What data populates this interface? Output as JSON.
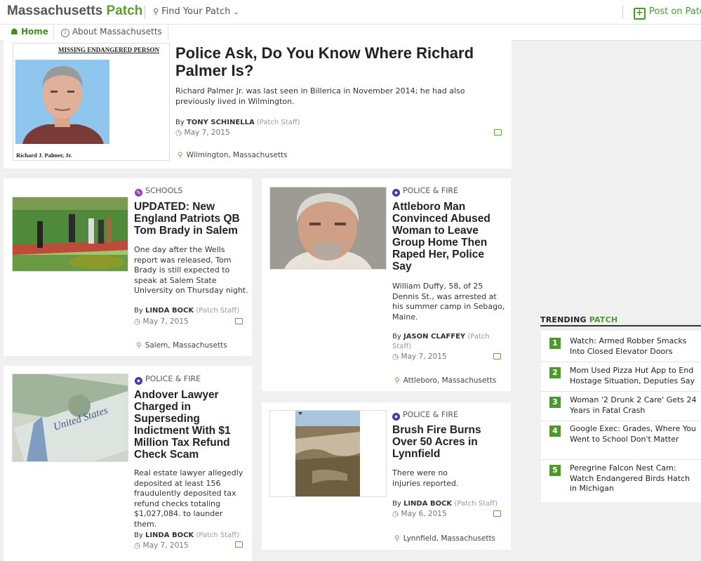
{
  "header": {
    "brand": "Massachusetts",
    "brand_patch": "Patch",
    "find_patch": "Find Your Patch",
    "post_on_patch": "Post on Patch"
  },
  "nav": {
    "home": "Home",
    "about": "About Massachusetts"
  },
  "featured": {
    "poster_header": "MISSING ENDANGERED PERSON",
    "poster_caption": "Richard J. Palmer, Jr.",
    "title": "Police Ask, Do You Know Where Richard Palmer Is?",
    "summary": "Richard Palmer Jr. was last seen in Billerica in November 2014; he had also previously lived in Wilmington.",
    "by": "By",
    "author": "TONY SCHINELLA",
    "staff": "(Patch Staff)",
    "date": "May 7, 2015",
    "location": "Wilmington, Massachusetts"
  },
  "articles": [
    {
      "category": "SCHOOLS",
      "title": "UPDATED: New England Patriots QB Tom Brady in Salem",
      "summary": "One day after the Wells report was released, Tom Brady is still expected to speak at Salem State University on Thursday night.",
      "author": "LINDA BOCK",
      "staff": "(Patch Staff)",
      "date": "May 7, 2015",
      "location": "Salem, Massachusetts"
    },
    {
      "category": "POLICE & FIRE",
      "title": "Attleboro Man Convinced Abused Woman to Leave Group Home Then Raped Her, Police Say",
      "summary": "William Duffy, 58, of 25 Dennis St., was arrested at his summer camp in Sebago, Maine.",
      "author": "JASON CLAFFEY",
      "staff": "(Patch Staff)",
      "date": "May 7, 2015",
      "location": "Attleboro, Massachusetts"
    },
    {
      "category": "POLICE & FIRE",
      "title": "Andover Lawyer Charged in Superseding Indictment With $1 Million Tax Refund Check Scam",
      "summary": "Real estate lawyer allegedly deposited at least 156 fraudulently deposited tax refund checks totaling $1,027,084. to launder them.",
      "author": "LINDA BOCK",
      "staff": "(Patch Staff)",
      "date": "May 7, 2015",
      "location": ""
    },
    {
      "category": "POLICE & FIRE",
      "title": "Brush Fire Burns Over 50 Acres in Lynnfield",
      "summary": "There were no injuries reported.",
      "author": "LINDA BOCK",
      "staff": "(Patch Staff)",
      "date": "May 6, 2015",
      "location": "Lynnfield, Massachusetts"
    }
  ],
  "trending": {
    "label": "TRENDING",
    "label_patch": "PATCH",
    "items": [
      {
        "num": "1",
        "text": "Watch: Armed Robber Smacks Into Closed Elevator Doors"
      },
      {
        "num": "2",
        "text": "Mom Used Pizza Hut App to End Hostage Situation, Deputies Say"
      },
      {
        "num": "3",
        "text": "Woman '2 Drunk 2 Care' Gets 24 Years in Fatal Crash"
      },
      {
        "num": "4",
        "text": "Google Exec: Grades, Where You Went to School Don't Matter"
      },
      {
        "num": "5",
        "text": "Peregrine Falcon Nest Cam: Watch Endangered Birds Hatch in Michigan"
      }
    ]
  },
  "colors": {
    "accent": "#4a9a2a",
    "schools": "#8e44ad",
    "police": "#3a3aa8"
  }
}
